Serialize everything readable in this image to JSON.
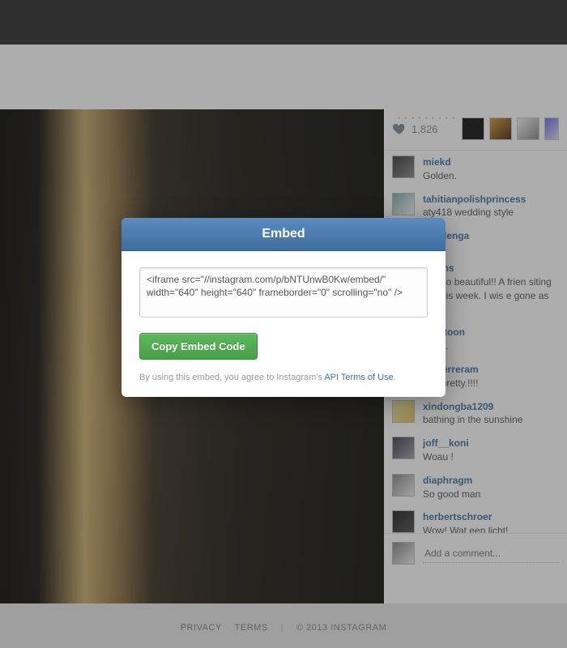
{
  "theme": {
    "accent": "#3f729b",
    "link_blue": "#3f729b",
    "button_green": "#48a048",
    "header_blue_top": "#5a8cbf",
    "header_blue_bottom": "#3f6d9f"
  },
  "likes": {
    "count": "1,826"
  },
  "comments": [
    {
      "user": "miekd",
      "text": "Golden."
    },
    {
      "user": "tahitianpolishprincess",
      "text": "aty418 wedding style"
    },
    {
      "user": "orbijlenga",
      "text": ""
    },
    {
      "user": "kerens",
      "text": "ekd so beautiful!! A frien siting SF this week. I wis e gone as well."
    },
    {
      "user": "thontoon",
      "text": "eless."
    },
    {
      "user": "ciaherreram",
      "text": "s to pretty.!!!!"
    },
    {
      "user": "xindongba1209",
      "text": "bathing in the sunshine"
    },
    {
      "user": "joff__koni",
      "text": "Woau !"
    },
    {
      "user": "diaphragm",
      "text": "So good man"
    },
    {
      "user": "herbertschroer",
      "text": "Wow! Wat een licht!"
    }
  ],
  "add_comment": {
    "placeholder": "Add a comment..."
  },
  "modal": {
    "title": "Embed",
    "embed_code": "<iframe src=\"//instagram.com/p/bNTUnwB0Kw/embed/\" width=\"640\" height=\"640\" frameborder=\"0\" scrolling=\"no\" />",
    "copy_label": "Copy Embed Code",
    "tos_prefix": "By using this embed, you agree to Instagram's ",
    "tos_link_label": "API Terms of Use",
    "tos_suffix": "."
  },
  "footer": {
    "privacy": "PRIVACY",
    "terms": "TERMS",
    "copyright": "© 2013 INSTAGRAM"
  }
}
